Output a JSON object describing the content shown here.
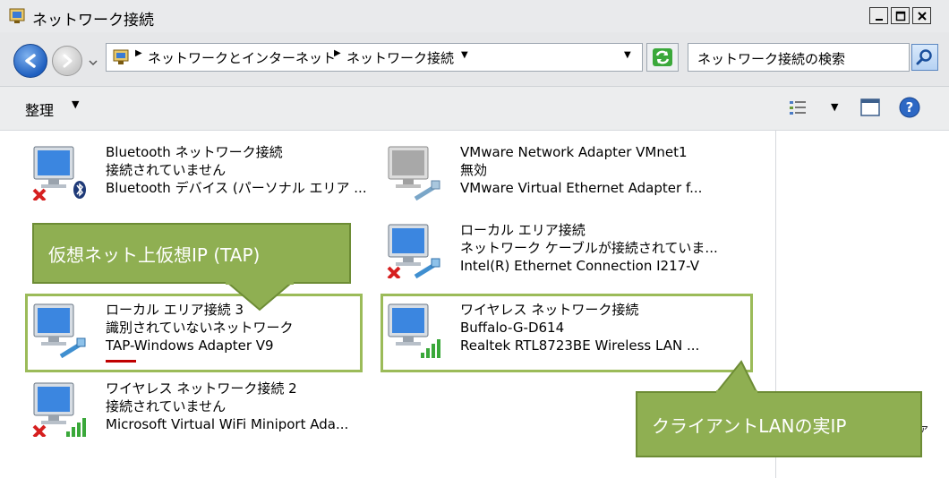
{
  "window": {
    "title": "ネットワーク接続"
  },
  "address": {
    "crumbs": [
      "ネットワークとインターネット",
      "ネットワーク接続"
    ],
    "search_placeholder": "ネットワーク接続の検索"
  },
  "toolbar": {
    "organize_label": "整理"
  },
  "items": [
    {
      "name": "Bluetooth ネットワーク接続",
      "status": "接続されていません",
      "device": "Bluetooth デバイス (パーソナル エリア ..."
    },
    {
      "name": "VMware Network Adapter VMnet1",
      "status": "無効",
      "device": "VMware Virtual Ethernet Adapter f..."
    },
    {
      "name": "ローカル エリア接続",
      "status": "ネットワーク ケーブルが接続されていま...",
      "device": "Intel(R) Ethernet Connection I217-V"
    },
    {
      "name": "ローカル エリア接続 3",
      "status": "識別されていないネットワーク",
      "device": "TAP-Windows Adapter V9"
    },
    {
      "name": "ワイヤレス ネットワーク接続",
      "status": "Buffalo-G-D614",
      "device": "Realtek RTL8723BE Wireless LAN ..."
    },
    {
      "name": "ワイヤレス ネットワーク接続 2",
      "status": "接続されていません",
      "device": "Microsoft Virtual WiFi Miniport Ada..."
    }
  ],
  "callouts": {
    "tap": "仮想ネット上仮想IP (TAP)",
    "lan": "クライアントLANの実IP"
  },
  "colors": {
    "callout_green": "#8faf52",
    "highlight_border": "#9bbb59",
    "underline_red": "#c00000"
  }
}
